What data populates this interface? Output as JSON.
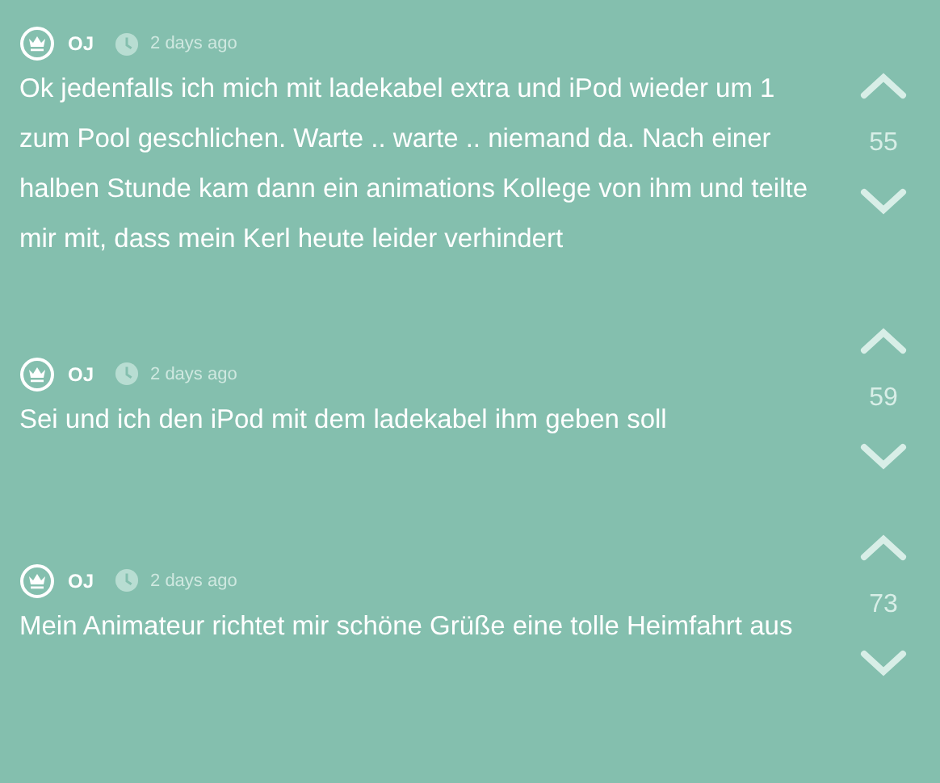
{
  "posts": [
    {
      "author": "OJ",
      "time": "2 days ago",
      "text": "Ok jedenfalls ich mich mit ladekabel extra und iPod wieder um 1 zum Pool geschlichen. Warte .. warte .. niemand da. Nach einer halben Stunde kam dann ein animations Kollege von ihm und teilte mir mit, dass mein Kerl heute leider verhindert",
      "votes": "55"
    },
    {
      "author": "OJ",
      "time": "2 days ago",
      "text": "Sei und ich den iPod mit dem ladekabel ihm geben soll",
      "votes": "59"
    },
    {
      "author": "OJ",
      "time": "2 days ago",
      "text": "Mein Animateur richtet mir schöne Grüße eine tolle Heimfahrt aus",
      "votes": "73"
    }
  ]
}
